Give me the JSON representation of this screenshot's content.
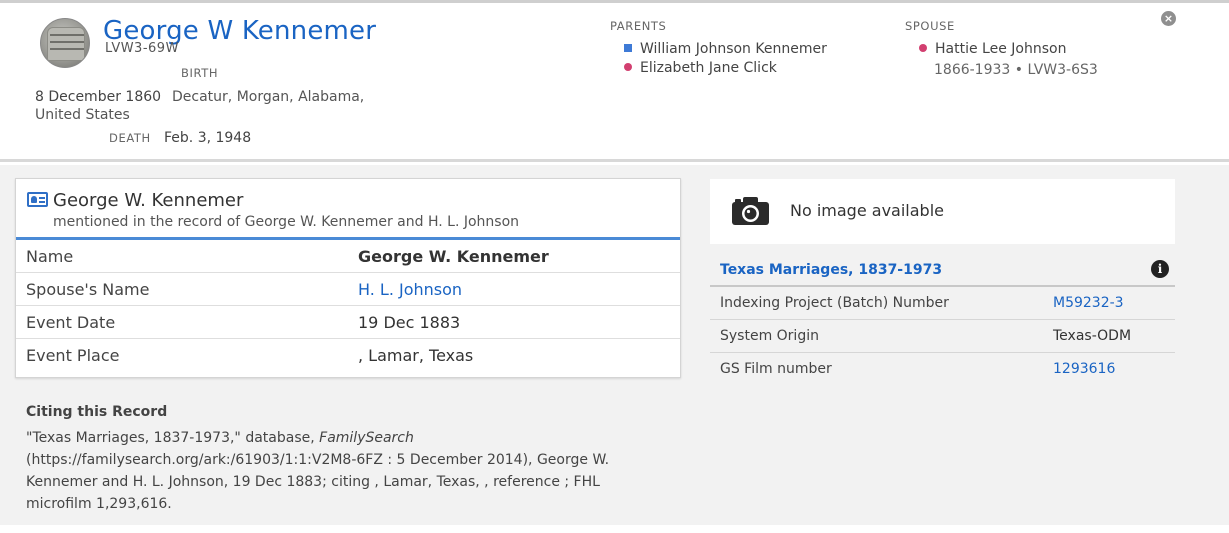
{
  "person": {
    "name": "George W Kennemer",
    "id": "LVW3-69W",
    "birth_label": "BIRTH",
    "birth_date": "8 December 1860",
    "birth_place_line1": "Decatur, Morgan, Alabama,",
    "birth_place_line2": "United States",
    "death_label": "DEATH",
    "death_date": "Feb. 3, 1948"
  },
  "parents": {
    "label": "PARENTS",
    "father": "William Johnson Kennemer",
    "mother": "Elizabeth Jane Click"
  },
  "spouse": {
    "label": "SPOUSE",
    "name": "Hattie Lee Johnson",
    "lifespan": "1866-1933 • LVW3-6S3"
  },
  "record": {
    "title": "George W. Kennemer",
    "subtitle": "mentioned in the record of George W. Kennemer and H. L. Johnson",
    "rows": [
      {
        "label": "Name",
        "value": "George W. Kennemer"
      },
      {
        "label": "Spouse's Name",
        "value": "H. L. Johnson"
      },
      {
        "label": "Event Date",
        "value": "19 Dec 1883"
      },
      {
        "label": "Event Place",
        "value": ", Lamar, Texas"
      }
    ]
  },
  "citation": {
    "title": "Citing this Record",
    "part1": "\"Texas Marriages, 1837-1973,\" database, ",
    "source": "FamilySearch",
    "part2": " (https://familysearch.org/ark:/61903/1:1:V2M8-6FZ : 5 December 2014), George W. Kennemer and H. L. Johnson, 19 Dec 1883; citing , Lamar, Texas, , reference ; FHL microfilm 1,293,616."
  },
  "image_panel": {
    "text": "No image available",
    "icon": "camera-icon"
  },
  "collection": {
    "title": "Texas Marriages, 1837-1973",
    "info_icon": "i",
    "rows": [
      {
        "label": "Indexing Project (Batch) Number",
        "value": "M59232-3"
      },
      {
        "label": "System Origin",
        "value": "Texas-ODM"
      },
      {
        "label": "GS Film number",
        "value": "1293616"
      }
    ]
  },
  "controls": {
    "close": "×"
  },
  "colors": {
    "link": "#1a64c3",
    "male": "#3e7ad6",
    "female": "#d23f70",
    "card_accent": "#4a8ad6",
    "background": "#f2f2f2"
  }
}
